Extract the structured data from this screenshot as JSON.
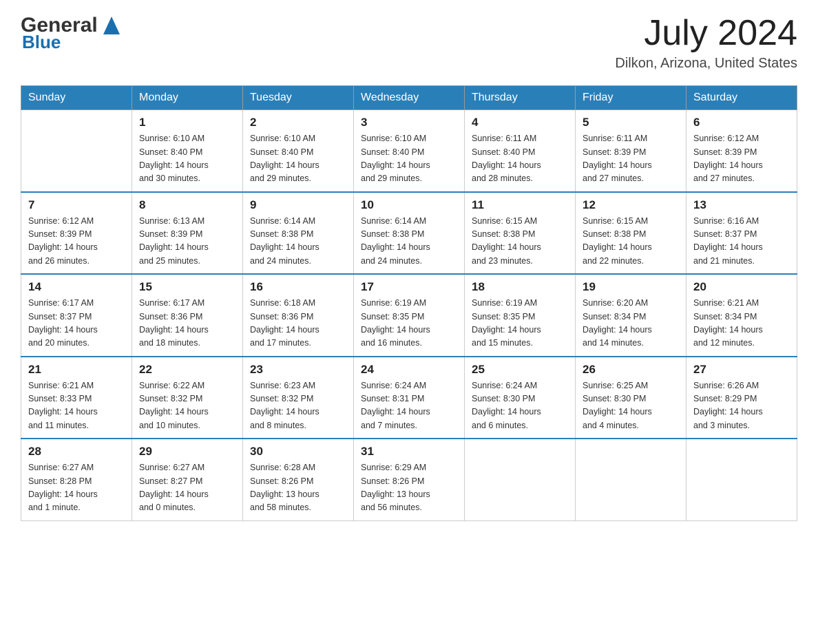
{
  "header": {
    "logo_general": "General",
    "logo_blue": "Blue",
    "month_title": "July 2024",
    "location": "Dilkon, Arizona, United States"
  },
  "days_of_week": [
    "Sunday",
    "Monday",
    "Tuesday",
    "Wednesday",
    "Thursday",
    "Friday",
    "Saturday"
  ],
  "weeks": [
    [
      {
        "day": "",
        "info": ""
      },
      {
        "day": "1",
        "info": "Sunrise: 6:10 AM\nSunset: 8:40 PM\nDaylight: 14 hours\nand 30 minutes."
      },
      {
        "day": "2",
        "info": "Sunrise: 6:10 AM\nSunset: 8:40 PM\nDaylight: 14 hours\nand 29 minutes."
      },
      {
        "day": "3",
        "info": "Sunrise: 6:10 AM\nSunset: 8:40 PM\nDaylight: 14 hours\nand 29 minutes."
      },
      {
        "day": "4",
        "info": "Sunrise: 6:11 AM\nSunset: 8:40 PM\nDaylight: 14 hours\nand 28 minutes."
      },
      {
        "day": "5",
        "info": "Sunrise: 6:11 AM\nSunset: 8:39 PM\nDaylight: 14 hours\nand 27 minutes."
      },
      {
        "day": "6",
        "info": "Sunrise: 6:12 AM\nSunset: 8:39 PM\nDaylight: 14 hours\nand 27 minutes."
      }
    ],
    [
      {
        "day": "7",
        "info": "Sunrise: 6:12 AM\nSunset: 8:39 PM\nDaylight: 14 hours\nand 26 minutes."
      },
      {
        "day": "8",
        "info": "Sunrise: 6:13 AM\nSunset: 8:39 PM\nDaylight: 14 hours\nand 25 minutes."
      },
      {
        "day": "9",
        "info": "Sunrise: 6:14 AM\nSunset: 8:38 PM\nDaylight: 14 hours\nand 24 minutes."
      },
      {
        "day": "10",
        "info": "Sunrise: 6:14 AM\nSunset: 8:38 PM\nDaylight: 14 hours\nand 24 minutes."
      },
      {
        "day": "11",
        "info": "Sunrise: 6:15 AM\nSunset: 8:38 PM\nDaylight: 14 hours\nand 23 minutes."
      },
      {
        "day": "12",
        "info": "Sunrise: 6:15 AM\nSunset: 8:38 PM\nDaylight: 14 hours\nand 22 minutes."
      },
      {
        "day": "13",
        "info": "Sunrise: 6:16 AM\nSunset: 8:37 PM\nDaylight: 14 hours\nand 21 minutes."
      }
    ],
    [
      {
        "day": "14",
        "info": "Sunrise: 6:17 AM\nSunset: 8:37 PM\nDaylight: 14 hours\nand 20 minutes."
      },
      {
        "day": "15",
        "info": "Sunrise: 6:17 AM\nSunset: 8:36 PM\nDaylight: 14 hours\nand 18 minutes."
      },
      {
        "day": "16",
        "info": "Sunrise: 6:18 AM\nSunset: 8:36 PM\nDaylight: 14 hours\nand 17 minutes."
      },
      {
        "day": "17",
        "info": "Sunrise: 6:19 AM\nSunset: 8:35 PM\nDaylight: 14 hours\nand 16 minutes."
      },
      {
        "day": "18",
        "info": "Sunrise: 6:19 AM\nSunset: 8:35 PM\nDaylight: 14 hours\nand 15 minutes."
      },
      {
        "day": "19",
        "info": "Sunrise: 6:20 AM\nSunset: 8:34 PM\nDaylight: 14 hours\nand 14 minutes."
      },
      {
        "day": "20",
        "info": "Sunrise: 6:21 AM\nSunset: 8:34 PM\nDaylight: 14 hours\nand 12 minutes."
      }
    ],
    [
      {
        "day": "21",
        "info": "Sunrise: 6:21 AM\nSunset: 8:33 PM\nDaylight: 14 hours\nand 11 minutes."
      },
      {
        "day": "22",
        "info": "Sunrise: 6:22 AM\nSunset: 8:32 PM\nDaylight: 14 hours\nand 10 minutes."
      },
      {
        "day": "23",
        "info": "Sunrise: 6:23 AM\nSunset: 8:32 PM\nDaylight: 14 hours\nand 8 minutes."
      },
      {
        "day": "24",
        "info": "Sunrise: 6:24 AM\nSunset: 8:31 PM\nDaylight: 14 hours\nand 7 minutes."
      },
      {
        "day": "25",
        "info": "Sunrise: 6:24 AM\nSunset: 8:30 PM\nDaylight: 14 hours\nand 6 minutes."
      },
      {
        "day": "26",
        "info": "Sunrise: 6:25 AM\nSunset: 8:30 PM\nDaylight: 14 hours\nand 4 minutes."
      },
      {
        "day": "27",
        "info": "Sunrise: 6:26 AM\nSunset: 8:29 PM\nDaylight: 14 hours\nand 3 minutes."
      }
    ],
    [
      {
        "day": "28",
        "info": "Sunrise: 6:27 AM\nSunset: 8:28 PM\nDaylight: 14 hours\nand 1 minute."
      },
      {
        "day": "29",
        "info": "Sunrise: 6:27 AM\nSunset: 8:27 PM\nDaylight: 14 hours\nand 0 minutes."
      },
      {
        "day": "30",
        "info": "Sunrise: 6:28 AM\nSunset: 8:26 PM\nDaylight: 13 hours\nand 58 minutes."
      },
      {
        "day": "31",
        "info": "Sunrise: 6:29 AM\nSunset: 8:26 PM\nDaylight: 13 hours\nand 56 minutes."
      },
      {
        "day": "",
        "info": ""
      },
      {
        "day": "",
        "info": ""
      },
      {
        "day": "",
        "info": ""
      }
    ]
  ]
}
